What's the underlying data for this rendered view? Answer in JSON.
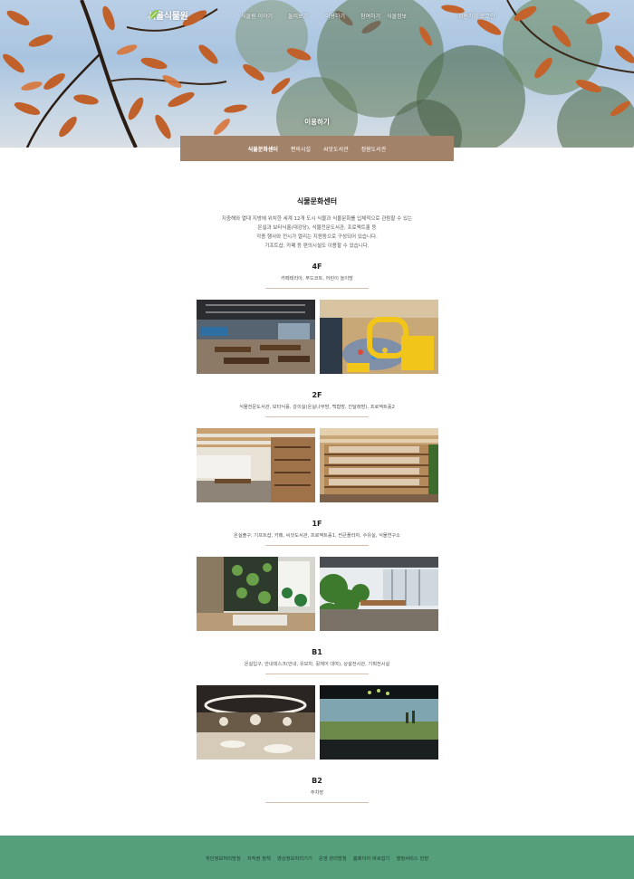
{
  "header": {
    "logo_text": "서울식물원",
    "nav": [
      "식물원 이야기",
      "둘러보기",
      "이용하기",
      "참여하기",
      "식물정보"
    ],
    "util": [
      "회원가입",
      "로그인"
    ],
    "page_title": "이용하기"
  },
  "submenu": {
    "items": [
      "식물문화센터",
      "편의시설",
      "씨앗도서관",
      "정원도서관"
    ]
  },
  "content": {
    "title": "식물문화센터",
    "intro": [
      "지중해와 열대 지방에 위치한 세계 12개 도시 식물과 식물문화를 입체적으로 관람할 수 있는",
      "온실과 보타닉홀(대강당), 식물전문도서관, 프로젝트홀 등",
      "각종 행사와 전시가 열리는 지원동으로 구성되어 있습니다.",
      "기프트샵, 카페 등 편의시설도 이용할 수 있습니다."
    ],
    "floors": [
      {
        "label": "4F",
        "desc": "카페테리아, 푸드코트, 어린이 놀이방",
        "photos": [
          "cafeteria-photo",
          "kids-playroom-photo"
        ]
      },
      {
        "label": "2F",
        "desc": "식물전문도서관, 보타닉홀, 강의실(온실나무방, 백합방, 진달래방), 프로젝트홀2",
        "photos": [
          "library-hall-photo",
          "library-shelves-photo"
        ]
      },
      {
        "label": "1F",
        "desc": "온실출구, 기프트샵, 카페, 씨앗도서관, 프로젝트홀1, 썬큰플라자, 수유실, 식물연구소",
        "photos": [
          "seed-library-photo",
          "cafe-garden-photo"
        ]
      },
      {
        "label": "B1",
        "desc": "온실입구, 안내데스크(안내, 유모차, 휠체어 대여), 상설전시관, 기획전시실",
        "photos": [
          "exhibition-hall-photo",
          "panorama-exhibit-photo"
        ]
      },
      {
        "label": "B2",
        "desc": "주차장",
        "photos": []
      }
    ]
  },
  "footer": {
    "links": [
      "개인정보처리방침",
      "저작권 정책",
      "영상정보처리기기",
      "운영 관리방침",
      "홈페이지 바로잡기",
      "행정서비스 헌장"
    ]
  },
  "colors": {
    "submenu_bg": "#a3826a",
    "footer_bg": "#55a07a",
    "divider": "#d9bfae"
  }
}
